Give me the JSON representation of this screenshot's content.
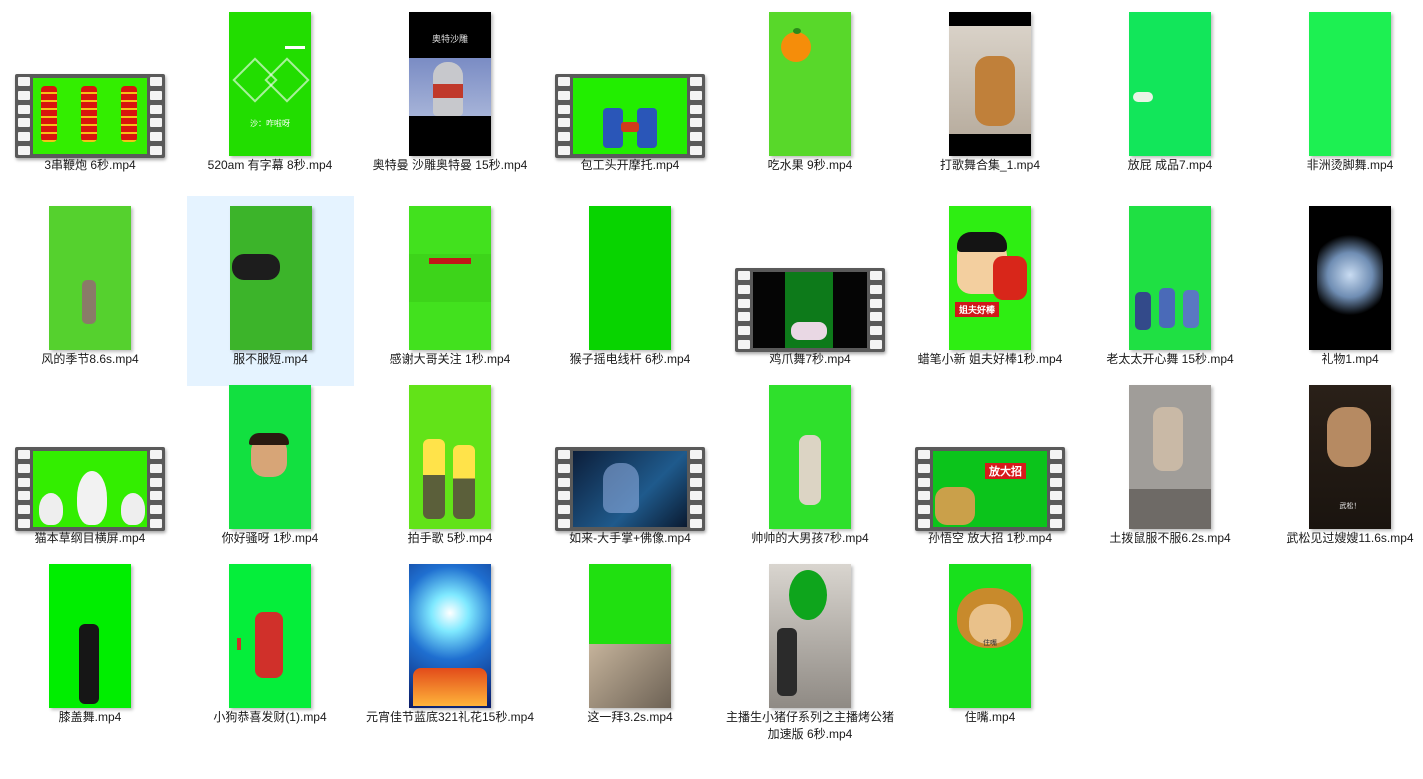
{
  "files": [
    {
      "name": "3串鞭炮 6秒.mp4",
      "thumb": "film"
    },
    {
      "name": "520am 有字幕 8秒.mp4",
      "thumb": "portrait",
      "overlay": "沙：咋啦呀"
    },
    {
      "name": "奥特曼 沙雕奥特曼 15秒.mp4",
      "thumb": "portrait",
      "overlay": "奥特沙雕"
    },
    {
      "name": "包工头开摩托.mp4",
      "thumb": "film"
    },
    {
      "name": "吃水果 9秒.mp4",
      "thumb": "portrait"
    },
    {
      "name": "打歌舞合集_1.mp4",
      "thumb": "portrait"
    },
    {
      "name": "放屁  成品7.mp4",
      "thumb": "portrait"
    },
    {
      "name": "非洲烫脚舞.mp4",
      "thumb": "portrait"
    },
    {
      "name": "风的季节8.6s.mp4",
      "thumb": "portrait"
    },
    {
      "name": "服不服短.mp4",
      "thumb": "portrait",
      "selected": true
    },
    {
      "name": "感谢大哥关注 1秒.mp4",
      "thumb": "portrait"
    },
    {
      "name": "猴子摇电线杆 6秒.mp4",
      "thumb": "portrait"
    },
    {
      "name": "鸡爪舞7秒.mp4",
      "thumb": "film"
    },
    {
      "name": "蜡笔小新 姐夫好棒1秒.mp4",
      "thumb": "portrait",
      "overlay": "姐夫好棒"
    },
    {
      "name": "老太太开心舞 15秒.mp4",
      "thumb": "portrait"
    },
    {
      "name": "礼物1.mp4",
      "thumb": "portrait"
    },
    {
      "name": "猫本草纲目横屏.mp4",
      "thumb": "film"
    },
    {
      "name": "你好骚呀 1秒.mp4",
      "thumb": "portrait"
    },
    {
      "name": "拍手歌  5秒.mp4",
      "thumb": "portrait"
    },
    {
      "name": "如来-大手掌+佛像.mp4",
      "thumb": "film"
    },
    {
      "name": "帅帅的大男孩7秒.mp4",
      "thumb": "portrait"
    },
    {
      "name": "孙悟空  放大招 1秒.mp4",
      "thumb": "film",
      "overlay": "放大招"
    },
    {
      "name": "土拨鼠服不服6.2s.mp4",
      "thumb": "portrait"
    },
    {
      "name": "武松见过嫂嫂11.6s.mp4",
      "thumb": "portrait",
      "overlay": "武松！"
    },
    {
      "name": "膝盖舞.mp4",
      "thumb": "portrait"
    },
    {
      "name": "小狗恭喜发财(1).mp4",
      "thumb": "portrait"
    },
    {
      "name": "元宵佳节蓝底321礼花15秒.mp4",
      "thumb": "portrait"
    },
    {
      "name": "这一拜3.2s.mp4",
      "thumb": "portrait"
    },
    {
      "name": "主播生小猪仔系列之主播烤公猪加速版 6秒.mp4",
      "thumb": "portrait"
    },
    {
      "name": "住嘴.mp4",
      "thumb": "portrait",
      "overlay": "住嘴"
    }
  ],
  "colors": {
    "selection": "#e5f3ff",
    "green_screen": "#2fe000",
    "film_frame": "#5a5a5a"
  }
}
